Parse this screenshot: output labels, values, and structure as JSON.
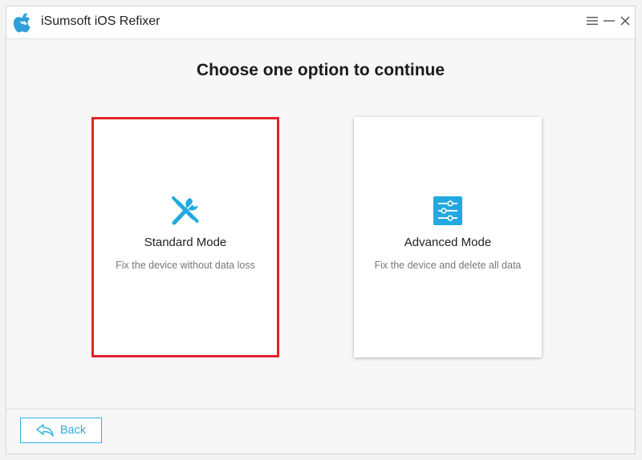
{
  "window": {
    "title": "iSumsoft iOS Refixer"
  },
  "main": {
    "heading": "Choose one option to continue",
    "options": [
      {
        "title": "Standard Mode",
        "description": "Fix the device without data loss",
        "icon": "wrench-screwdriver-icon",
        "selected": true
      },
      {
        "title": "Advanced Mode",
        "description": "Fix the device and delete all data",
        "icon": "sliders-icon",
        "selected": false
      }
    ]
  },
  "footer": {
    "back_label": "Back",
    "back_icon": "back-arrow-icon"
  },
  "colors": {
    "accent": "#34b3e4",
    "selected_border": "#e32329"
  }
}
